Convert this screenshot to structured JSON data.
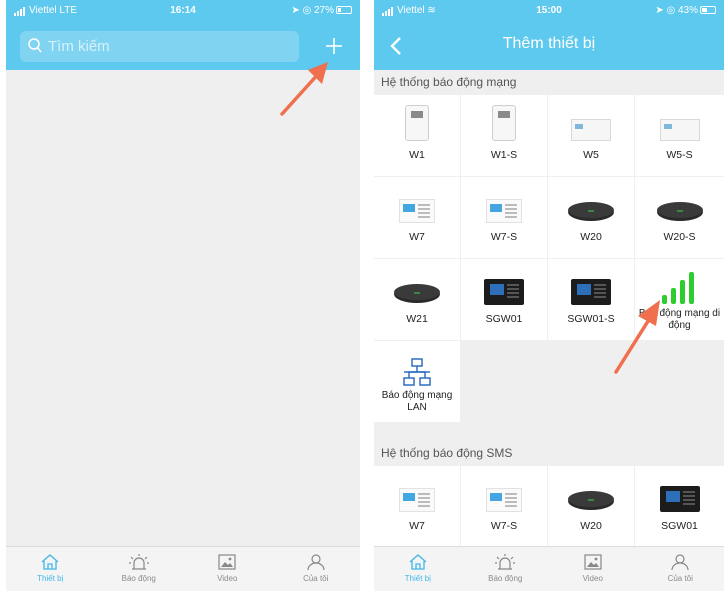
{
  "left": {
    "status": {
      "carrier": "Viettel  LTE",
      "time": "16:14",
      "battery": "27%",
      "battery_level": 0.27
    },
    "search": {
      "placeholder": "Tìm kiếm"
    },
    "tabs": [
      {
        "label": "Thiết bị",
        "icon": "home-icon",
        "active": true
      },
      {
        "label": "Báo động",
        "icon": "alarm-icon",
        "active": false
      },
      {
        "label": "Video",
        "icon": "image-icon",
        "active": false
      },
      {
        "label": "Của tôi",
        "icon": "user-icon",
        "active": false
      }
    ]
  },
  "right": {
    "status": {
      "carrier": "Viettel",
      "time": "15:00",
      "battery": "43%",
      "battery_level": 0.43
    },
    "title": "Thêm thiết bị",
    "sections": [
      {
        "title": "Hệ thống báo động mạng",
        "devices": [
          {
            "name": "W1",
            "icon": "panel-tall"
          },
          {
            "name": "W1-S",
            "icon": "panel-tall"
          },
          {
            "name": "W5",
            "icon": "panel-flat"
          },
          {
            "name": "W5-S",
            "icon": "panel-flat"
          },
          {
            "name": "W7",
            "icon": "keypad"
          },
          {
            "name": "W7-S",
            "icon": "keypad"
          },
          {
            "name": "W20",
            "icon": "hub"
          },
          {
            "name": "W20-S",
            "icon": "hub"
          },
          {
            "name": "W21",
            "icon": "hub"
          },
          {
            "name": "SGW01",
            "icon": "black-panel"
          },
          {
            "name": "SGW01-S",
            "icon": "black-panel"
          },
          {
            "name": "Báo động mạng di động",
            "icon": "signal-bars"
          },
          {
            "name": "Báo động mạng LAN",
            "icon": "network"
          }
        ]
      },
      {
        "title": "Hệ thống báo động SMS",
        "devices": [
          {
            "name": "W7",
            "icon": "keypad"
          },
          {
            "name": "W7-S",
            "icon": "keypad"
          },
          {
            "name": "W20",
            "icon": "hub"
          },
          {
            "name": "SGW01",
            "icon": "black-panel"
          }
        ]
      }
    ],
    "tabs": [
      {
        "label": "Thiết bị",
        "icon": "home-icon",
        "active": true
      },
      {
        "label": "Báo động",
        "icon": "alarm-icon",
        "active": false
      },
      {
        "label": "Video",
        "icon": "image-icon",
        "active": false
      },
      {
        "label": "Của tôi",
        "icon": "user-icon",
        "active": false
      }
    ]
  },
  "colors": {
    "accent": "#5ec9ee",
    "active_tab": "#3fb8e8",
    "arrow": "#f06f4e",
    "signal": "#2ecc2e"
  }
}
